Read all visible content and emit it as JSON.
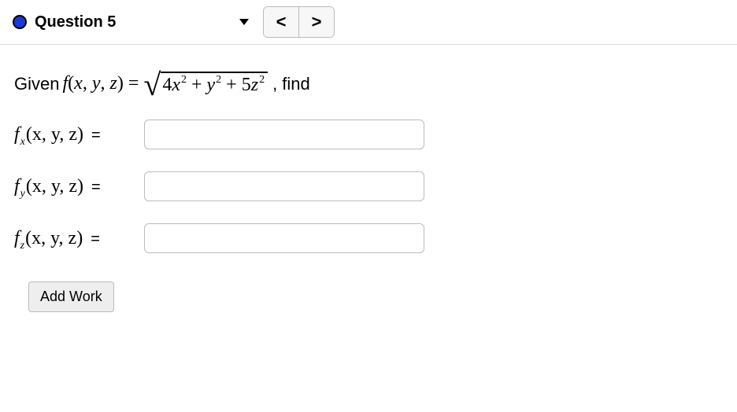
{
  "header": {
    "question_label": "Question 5",
    "prev_glyph": "<",
    "next_glyph": ">"
  },
  "prompt": {
    "lead": "Given ",
    "func": "f",
    "args_open": "(",
    "x": "x",
    "comma": ", ",
    "y": "y",
    "z": "z",
    "args_close": ")",
    "equals": " = ",
    "rad_4": "4",
    "rad_x": "x",
    "rad_sq": "2",
    "rad_plus": " + ",
    "rad_y": "y",
    "rad_5": "5",
    "rad_z": "z",
    "tail": ", find"
  },
  "rows": {
    "fx": {
      "f": "f",
      "sub": "x",
      "args": "(x, y, z)",
      "eq": "="
    },
    "fy": {
      "f": "f",
      "sub": "y",
      "args": "(x, y, z)",
      "eq": "="
    },
    "fz": {
      "f": "f",
      "sub": "z",
      "args": "(x, y, z)",
      "eq": "="
    }
  },
  "buttons": {
    "add_work": "Add Work"
  }
}
